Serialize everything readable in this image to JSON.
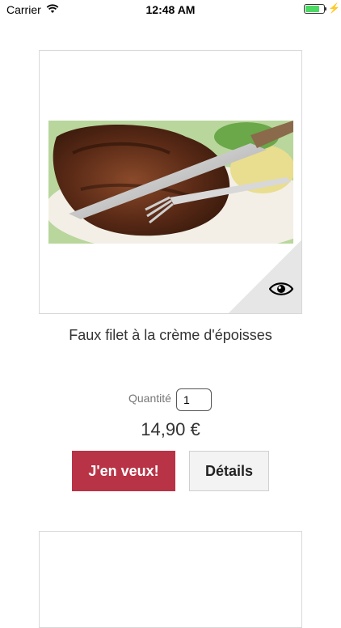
{
  "status_bar": {
    "carrier": "Carrier",
    "time": "12:48 AM",
    "battery_level": 0.85,
    "icons": [
      "wifi-icon",
      "battery-icon",
      "charging-bolt-icon"
    ]
  },
  "product": {
    "image": "grilled-steak-with-knife-and-fork",
    "preview_icon": "eye-icon",
    "title": "Faux filet à la crème d'époisses",
    "quantity_label": "Quantité",
    "quantity_value": "1",
    "price": "14,90 €",
    "buy_button": "J'en veux!",
    "details_button": "Détails"
  },
  "colors": {
    "buy_button": "#b83346",
    "details_button": "#f3f3f3",
    "battery": "#4cd964"
  }
}
